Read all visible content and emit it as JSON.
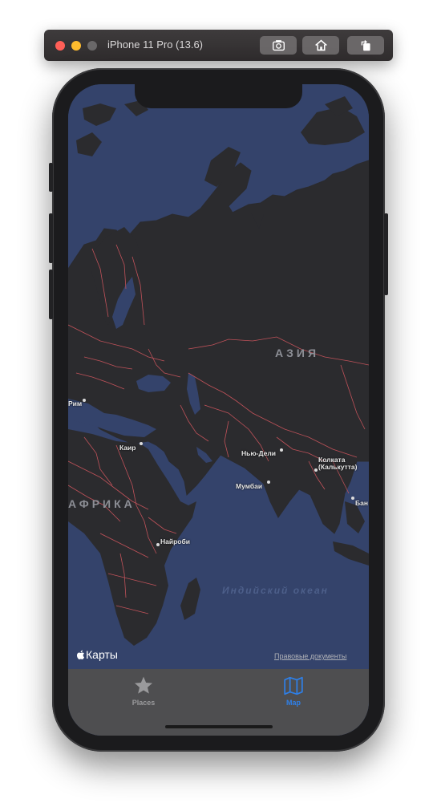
{
  "simulator": {
    "title": "iPhone 11 Pro (13.6)",
    "buttons": [
      "screenshot-icon",
      "home-icon",
      "rotate-icon"
    ]
  },
  "map": {
    "regions": {
      "asia": "АЗИЯ",
      "africa": "АФРИКА"
    },
    "ocean": "Индийский океан",
    "cities": {
      "rome": "Рим",
      "cairo": "Каир",
      "delhi": "Нью-Дели",
      "mumbai": "Мумбаи",
      "kolkata_1": "Колката",
      "kolkata_2": "(Калькутта)",
      "bangkok": "Бан",
      "nairobi": "Найроби"
    },
    "brand": "Карты",
    "legal": "Правовые документы"
  },
  "tabbar": {
    "items": [
      {
        "label": "Places",
        "icon": "star-icon",
        "selected": false
      },
      {
        "label": "Map",
        "icon": "map-icon",
        "selected": true
      }
    ],
    "colors": {
      "active": "#2f7fe6",
      "inactive": "#9a9a9c"
    }
  },
  "colors": {
    "land": "#2b2b2e",
    "water": "#34436b",
    "border": "#c8545c"
  }
}
